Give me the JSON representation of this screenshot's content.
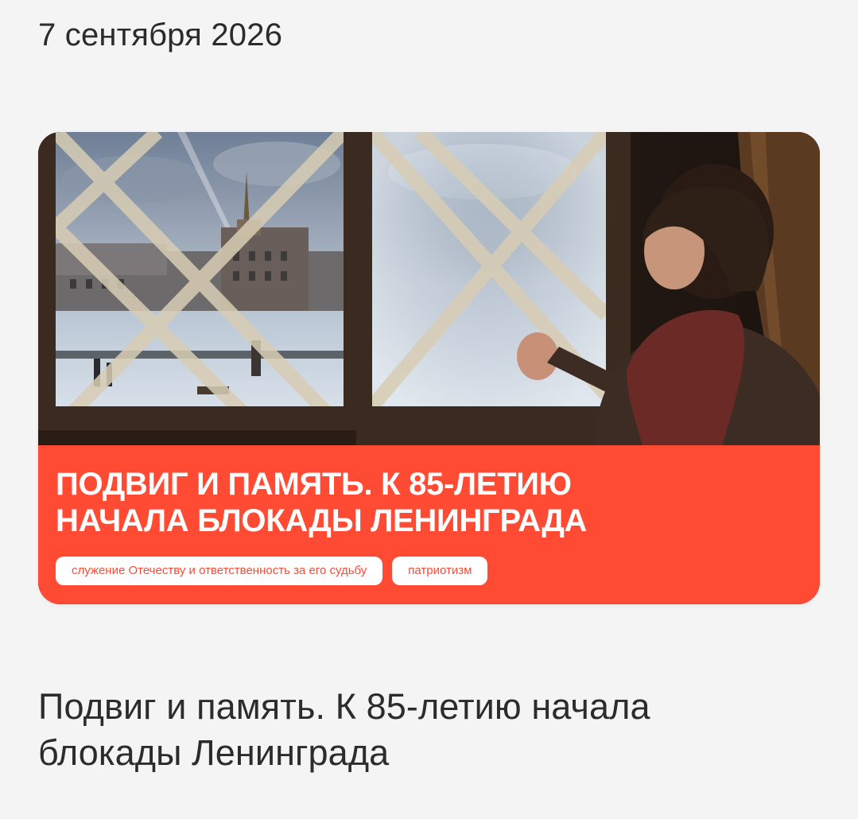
{
  "date": "7 сентября 2026",
  "card": {
    "image_description_icon": "blockade-window-illustration",
    "banner_title_line1": "ПОДВИГ И ПАМЯТЬ. К 85-ЛЕТИЮ",
    "banner_title_line2": "НАЧАЛА БЛОКАДЫ ЛЕНИНГРАДА",
    "tags": [
      "служение Отечеству и ответственность за его судьбу",
      "патриотизм"
    ],
    "accent_color": "#ff4a34"
  },
  "headline": "Подвиг и память. К 85-летию начала блокады Ленинграда"
}
